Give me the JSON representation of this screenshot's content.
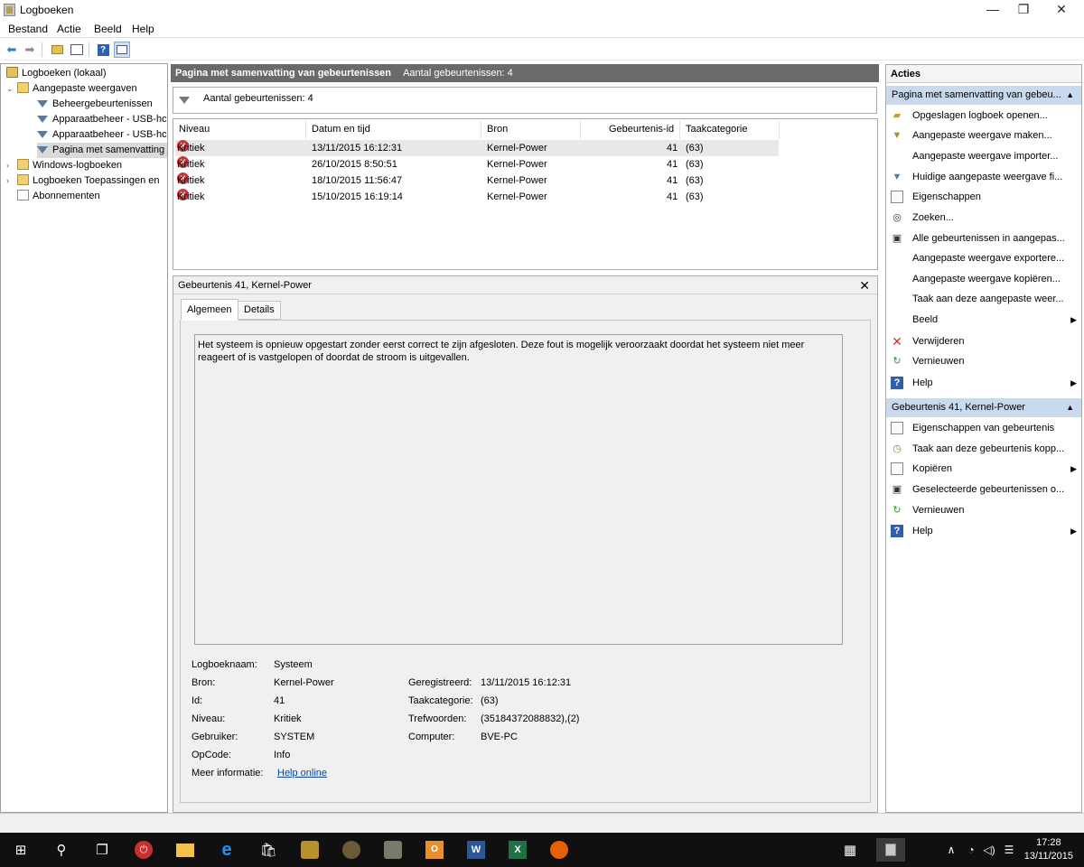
{
  "window": {
    "title": "Logboeken",
    "minimize": "—",
    "restore": "❐",
    "close": "✕"
  },
  "menu": [
    "Bestand",
    "Actie",
    "Beeld",
    "Help"
  ],
  "tree": {
    "root": "Logboeken (lokaal)",
    "custom_views": "Aangepaste weergaven",
    "items": [
      "Beheergebeurtenissen",
      "Apparaatbeheer - USB-hc",
      "Apparaatbeheer - USB-hc",
      "Pagina met samenvatting"
    ],
    "windows_logs": "Windows-logboeken",
    "app_logs": "Logboeken Toepassingen en",
    "subscriptions": "Abonnementen"
  },
  "summary": {
    "header_title": "Pagina met samenvatting van gebeurtenissen",
    "header_count": "Aantal gebeurtenissen: 4",
    "filter_text": "Aantal gebeurtenissen: 4"
  },
  "table": {
    "columns": [
      "Niveau",
      "Datum en tijd",
      "Bron",
      "Gebeurtenis-id",
      "Taakcategorie"
    ],
    "rows": [
      {
        "level": "Kritiek",
        "date": "13/11/2015 16:12:31",
        "source": "Kernel-Power",
        "id": "41",
        "category": "(63)"
      },
      {
        "level": "Kritiek",
        "date": "26/10/2015 8:50:51",
        "source": "Kernel-Power",
        "id": "41",
        "category": "(63)"
      },
      {
        "level": "Kritiek",
        "date": "18/10/2015 11:56:47",
        "source": "Kernel-Power",
        "id": "41",
        "category": "(63)"
      },
      {
        "level": "Kritiek",
        "date": "15/10/2015 16:19:14",
        "source": "Kernel-Power",
        "id": "41",
        "category": "(63)"
      }
    ]
  },
  "detail": {
    "title": "Gebeurtenis 41, Kernel-Power",
    "close": "✕",
    "tabs": [
      "Algemeen",
      "Details"
    ],
    "description": "Het systeem is opnieuw opgestart zonder eerst correct te zijn afgesloten. Deze fout is mogelijk veroorzaakt doordat het systeem niet meer reageert of is vastgelopen of doordat de stroom is uitgevallen.",
    "labels": {
      "log_name": "Logboeknaam:",
      "source": "Bron:",
      "id": "Id:",
      "level": "Niveau:",
      "user": "Gebruiker:",
      "opcode": "OpCode:",
      "more_info": "Meer informatie:",
      "logged": "Geregistreerd:",
      "task_category": "Taakcategorie:",
      "keywords": "Trefwoorden:",
      "computer": "Computer:"
    },
    "values": {
      "log_name": "Systeem",
      "source": "Kernel-Power",
      "id": "41",
      "level": "Kritiek",
      "user": "SYSTEM",
      "opcode": "Info",
      "more_info": "Help online",
      "logged": "13/11/2015 16:12:31",
      "task_category": "(63)",
      "keywords": "(35184372088832),(2)",
      "computer": "BVE-PC"
    }
  },
  "actions": {
    "title": "Acties",
    "section1": "Pagina met samenvatting van gebeu...",
    "items1": [
      "Opgeslagen logboek openen...",
      "Aangepaste weergave maken...",
      "Aangepaste weergave importer...",
      "Huidige aangepaste weergave fi...",
      "Eigenschappen",
      "Zoeken...",
      "Alle gebeurtenissen in aangepas...",
      "Aangepaste weergave exportere...",
      "Aangepaste weergave kopiëren...",
      "Taak aan deze aangepaste weer...",
      "Beeld",
      "Verwijderen",
      "Vernieuwen",
      "Help"
    ],
    "section2": "Gebeurtenis 41, Kernel-Power",
    "items2": [
      "Eigenschappen van gebeurtenis",
      "Taak aan deze gebeurtenis kopp...",
      "Kopiëren",
      "Geselecteerde gebeurtenissen o...",
      "Vernieuwen",
      "Help"
    ]
  },
  "taskbar": {
    "time": "17:28",
    "date": "13/11/2015"
  },
  "colors": {
    "section_bg": "#c9daee",
    "header_bg": "#6a6a6a",
    "critical": "#c8373c",
    "taskbar": "#101010"
  }
}
